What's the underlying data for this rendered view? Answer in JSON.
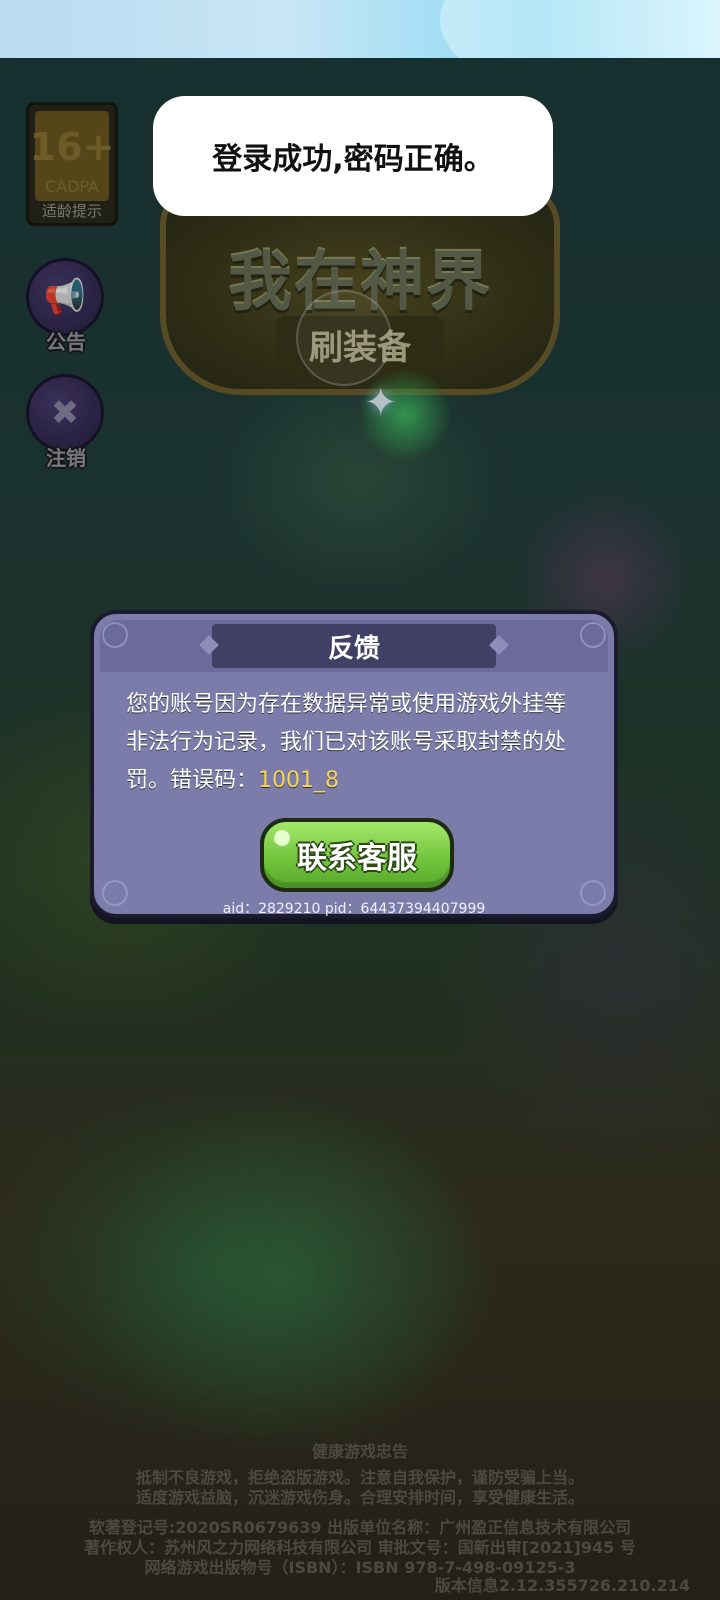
{
  "toast": {
    "text": "登录成功,密码正确。"
  },
  "age_rating": {
    "age": "16+",
    "org": "CADPA",
    "tip": "适龄提示"
  },
  "side_buttons": [
    {
      "label": "公告",
      "icon": "megaphone-icon"
    },
    {
      "label": "注销",
      "icon": "logout-icon"
    }
  ],
  "game_logo": {
    "title": "我在神界",
    "subtitle": "刷装备"
  },
  "dialog": {
    "title": "反馈",
    "message": "您的账号因为存在数据异常或使用游戏外挂等非法行为记录，我们已对该账号采取封禁的处罚。错误码：",
    "error_code": "1001_8",
    "button_label": "联系客服",
    "ids": "aid：2829210  pid：64437394407999"
  },
  "footer": {
    "heading": "健康游戏忠告",
    "advice_line1": "抵制不良游戏，拒绝盗版游戏。注意自我保护，谨防受骗上当。",
    "advice_line2": "适度游戏益脑，沉迷游戏伤身。合理安排时间，享受健康生活。",
    "copyright_line1": "软著登记号:2020SR0679639 出版单位名称：广州盈正信息技术有限公司",
    "copyright_line2": "著作权人：苏州风之力网络科技有限公司 审批文号：国新出审[2021]945 号",
    "copyright_line3": "网络游戏出版物号（ISBN）：ISBN 978-7-498-09125-3",
    "version": "版本信息2.12.355726.210.214"
  },
  "colors": {
    "dialog_bg": "#7c7cab",
    "title_bar": "#403f66",
    "button_green": "#6fc23a",
    "error_code": "#f5d55a"
  }
}
